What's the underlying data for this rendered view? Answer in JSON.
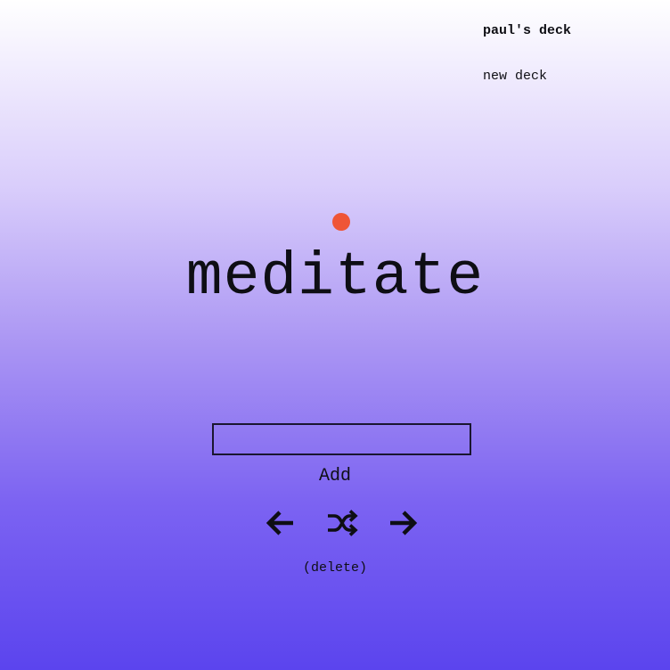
{
  "decks": {
    "current_label": "paul's deck",
    "new_label": "new deck"
  },
  "card": {
    "word": "meditate",
    "dot_color": "#ef5536"
  },
  "entry": {
    "value": "",
    "placeholder": ""
  },
  "actions": {
    "add_label": "Add",
    "delete_label": "(delete)"
  },
  "icons": {
    "prev": "arrow-left-icon",
    "shuffle": "shuffle-icon",
    "next": "arrow-right-icon"
  },
  "colors": {
    "text": "#0e0e14",
    "gradient_top": "#ffffff",
    "gradient_bottom": "#5b44ee"
  }
}
